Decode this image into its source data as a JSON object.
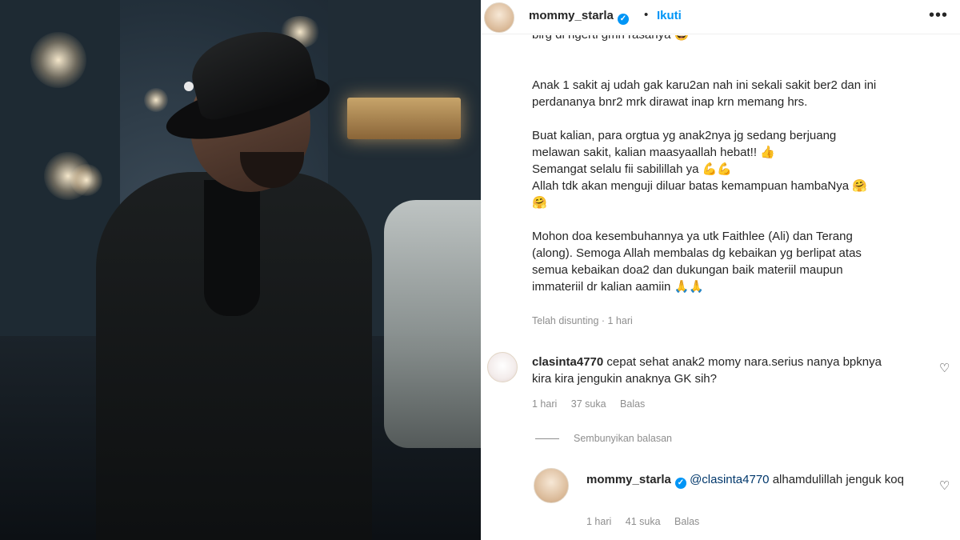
{
  "post": {
    "username": "mommy_starla",
    "verified": true,
    "dot": "•",
    "follow_label": "Ikuti",
    "more_icon": "•••",
    "cut_text": "blrg di ngerti gmn rasanya 😅",
    "caption": {
      "p1": [
        "Anak 1 sakit aj udah gak karu2an nah ini sekali sakit ber2 dan ini",
        "perdananya bnr2 mrk dirawat inap krn memang hrs."
      ],
      "p2": [
        "Buat kalian, para orgtua yg anak2nya jg sedang berjuang",
        "melawan sakit, kalian maasyaallah hebat!! 👍",
        "Semangat selalu fii sabilillah ya 💪💪",
        "Allah tdk akan menguji diluar batas kemampuan hambaNya 🤗",
        "🤗"
      ],
      "p3": [
        "Mohon doa kesembuhannya ya utk Faithlee (Ali) dan Terang",
        "(along). Semoga Allah membalas dg kebaikan yg berlipat atas",
        "semua kebaikan doa2 dan dukungan baik materiil maupun",
        "immateriil dr kalian aamiin 🙏🙏"
      ]
    },
    "edited_meta": "Telah disunting · 1 hari"
  },
  "comments": [
    {
      "username": "clasinta4770",
      "text": "cepat sehat anak2 momy nara.serius nanya bpknya kira kira jengukin anaknya GK sih?",
      "time": "1 hari",
      "likes": "37 suka",
      "reply_label": "Balas"
    }
  ],
  "hide_replies_label": "Sembunyikan balasan",
  "reply": {
    "username": "mommy_starla",
    "mention": "@clasinta4770",
    "text": " alhamdulillah jenguk koq",
    "time": "1 hari",
    "likes": "41 suka",
    "reply_label": "Balas"
  },
  "icons": {
    "heart": "♡",
    "verified": "✓"
  }
}
